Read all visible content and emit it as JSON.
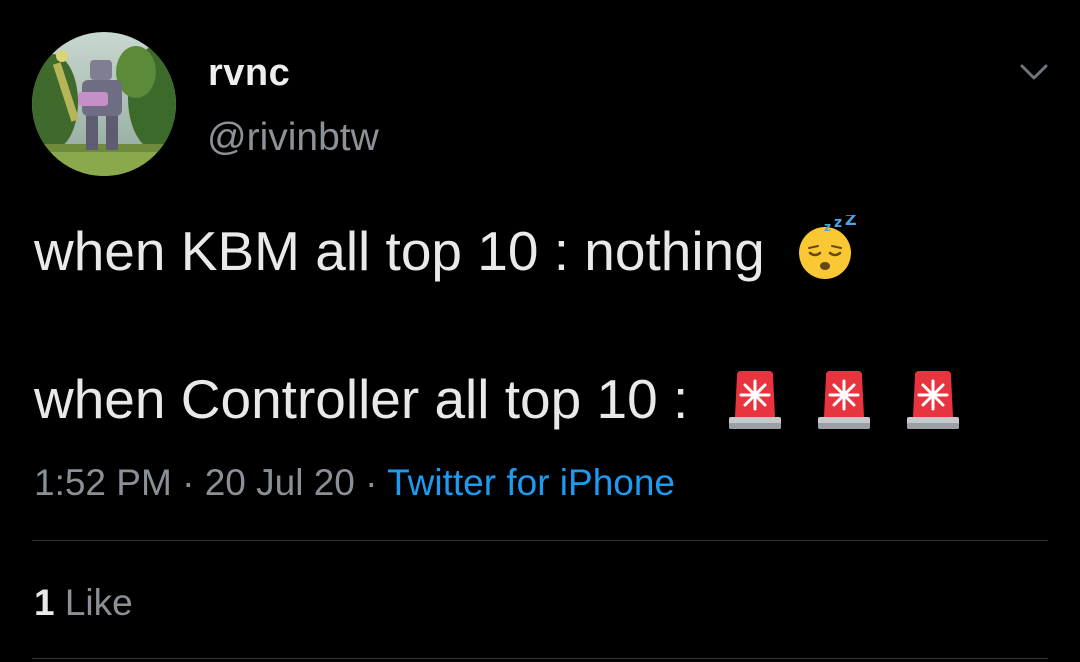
{
  "tweet": {
    "display_name": "rvnc",
    "handle": "@rivinbtw",
    "line1_text": "when KBM all top 10 : nothing",
    "line1_emoji": "sleeping-face",
    "line2_text": "when Controller all top 10 :",
    "line2_emojis": [
      "police-light",
      "police-light",
      "police-light"
    ],
    "time": "1:52 PM",
    "separator": "·",
    "date": "20 Jul 20",
    "source": "Twitter for iPhone",
    "like_count": "1",
    "like_label": "Like"
  },
  "icons": {
    "menu": "chevron-down-icon",
    "avatar": "profile-avatar"
  },
  "colors": {
    "background": "#000000",
    "link": "#1d9bf0",
    "secondary_text": "#8a9096",
    "divider": "#2f3336"
  }
}
